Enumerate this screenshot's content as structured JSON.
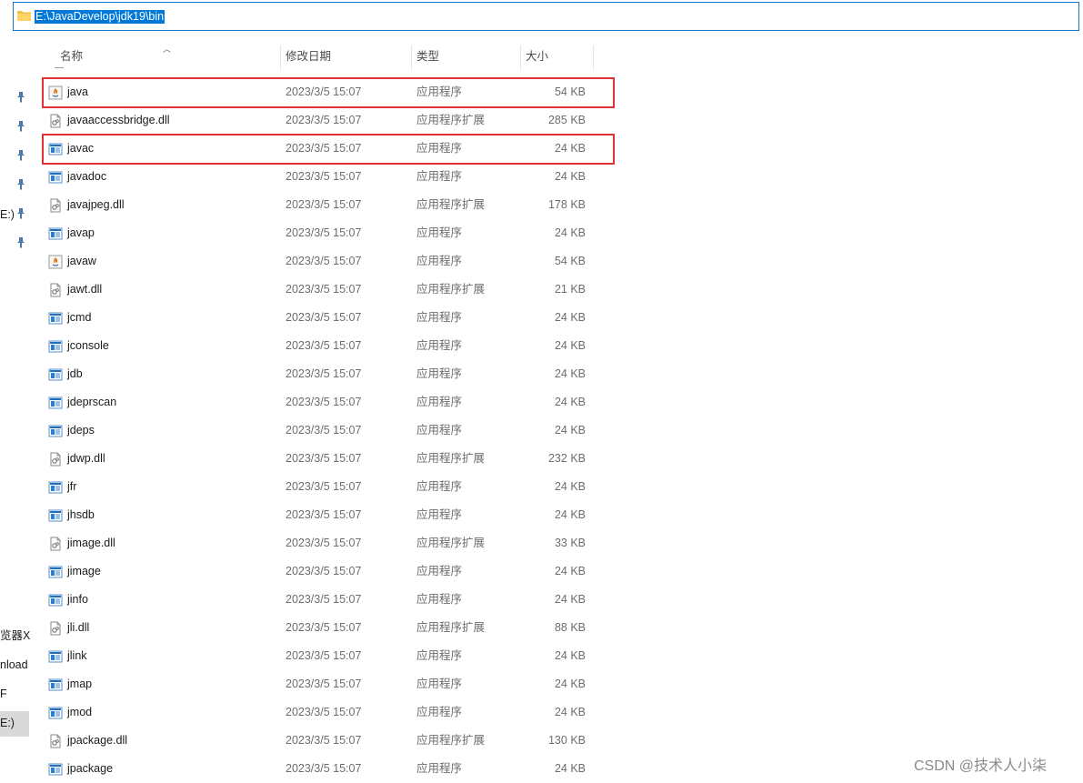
{
  "address": {
    "path": "E:\\JavaDevelop\\jdk19\\bin"
  },
  "nav": {
    "labels": [
      "E:)",
      "览器X",
      "nload",
      "F",
      "E:)"
    ]
  },
  "columns": {
    "name": "名称",
    "date": "修改日期",
    "type": "类型",
    "size": "大小"
  },
  "files": [
    {
      "name": "java",
      "date": "2023/3/5 15:07",
      "type": "应用程序",
      "size": "54 KB",
      "icon": "java-app-icon"
    },
    {
      "name": "javaaccessbridge.dll",
      "date": "2023/3/5 15:07",
      "type": "应用程序扩展",
      "size": "285 KB",
      "icon": "dll-icon"
    },
    {
      "name": "javac",
      "date": "2023/3/5 15:07",
      "type": "应用程序",
      "size": "24 KB",
      "icon": "exe-icon"
    },
    {
      "name": "javadoc",
      "date": "2023/3/5 15:07",
      "type": "应用程序",
      "size": "24 KB",
      "icon": "exe-icon"
    },
    {
      "name": "javajpeg.dll",
      "date": "2023/3/5 15:07",
      "type": "应用程序扩展",
      "size": "178 KB",
      "icon": "dll-icon"
    },
    {
      "name": "javap",
      "date": "2023/3/5 15:07",
      "type": "应用程序",
      "size": "24 KB",
      "icon": "exe-icon"
    },
    {
      "name": "javaw",
      "date": "2023/3/5 15:07",
      "type": "应用程序",
      "size": "54 KB",
      "icon": "java-app-icon"
    },
    {
      "name": "jawt.dll",
      "date": "2023/3/5 15:07",
      "type": "应用程序扩展",
      "size": "21 KB",
      "icon": "dll-icon"
    },
    {
      "name": "jcmd",
      "date": "2023/3/5 15:07",
      "type": "应用程序",
      "size": "24 KB",
      "icon": "exe-icon"
    },
    {
      "name": "jconsole",
      "date": "2023/3/5 15:07",
      "type": "应用程序",
      "size": "24 KB",
      "icon": "exe-icon"
    },
    {
      "name": "jdb",
      "date": "2023/3/5 15:07",
      "type": "应用程序",
      "size": "24 KB",
      "icon": "exe-icon"
    },
    {
      "name": "jdeprscan",
      "date": "2023/3/5 15:07",
      "type": "应用程序",
      "size": "24 KB",
      "icon": "exe-icon"
    },
    {
      "name": "jdeps",
      "date": "2023/3/5 15:07",
      "type": "应用程序",
      "size": "24 KB",
      "icon": "exe-icon"
    },
    {
      "name": "jdwp.dll",
      "date": "2023/3/5 15:07",
      "type": "应用程序扩展",
      "size": "232 KB",
      "icon": "dll-icon"
    },
    {
      "name": "jfr",
      "date": "2023/3/5 15:07",
      "type": "应用程序",
      "size": "24 KB",
      "icon": "exe-icon"
    },
    {
      "name": "jhsdb",
      "date": "2023/3/5 15:07",
      "type": "应用程序",
      "size": "24 KB",
      "icon": "exe-icon"
    },
    {
      "name": "jimage.dll",
      "date": "2023/3/5 15:07",
      "type": "应用程序扩展",
      "size": "33 KB",
      "icon": "dll-icon"
    },
    {
      "name": "jimage",
      "date": "2023/3/5 15:07",
      "type": "应用程序",
      "size": "24 KB",
      "icon": "exe-icon"
    },
    {
      "name": "jinfo",
      "date": "2023/3/5 15:07",
      "type": "应用程序",
      "size": "24 KB",
      "icon": "exe-icon"
    },
    {
      "name": "jli.dll",
      "date": "2023/3/5 15:07",
      "type": "应用程序扩展",
      "size": "88 KB",
      "icon": "dll-icon"
    },
    {
      "name": "jlink",
      "date": "2023/3/5 15:07",
      "type": "应用程序",
      "size": "24 KB",
      "icon": "exe-icon"
    },
    {
      "name": "jmap",
      "date": "2023/3/5 15:07",
      "type": "应用程序",
      "size": "24 KB",
      "icon": "exe-icon"
    },
    {
      "name": "jmod",
      "date": "2023/3/5 15:07",
      "type": "应用程序",
      "size": "24 KB",
      "icon": "exe-icon"
    },
    {
      "name": "jpackage.dll",
      "date": "2023/3/5 15:07",
      "type": "应用程序扩展",
      "size": "130 KB",
      "icon": "dll-icon"
    },
    {
      "name": "jpackage",
      "date": "2023/3/5 15:07",
      "type": "应用程序",
      "size": "24 KB",
      "icon": "exe-icon"
    }
  ],
  "highlighted": [
    "java",
    "javac"
  ],
  "watermark": "CSDN @技术人小柒",
  "colors": {
    "highlight": "#e0323a",
    "selection": "#0078d7",
    "exe_icon": "#1e6fbf"
  }
}
